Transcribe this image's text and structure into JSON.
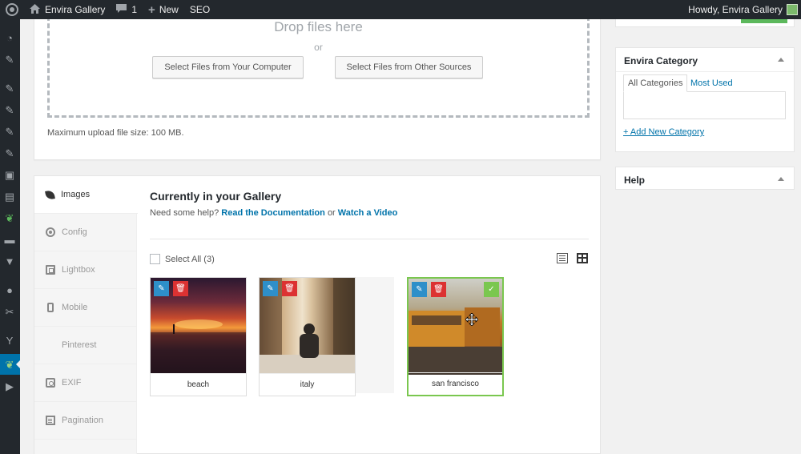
{
  "adminbar": {
    "site_name": "Envira Gallery",
    "comments_count": "1",
    "new_label": "New",
    "seo_label": "SEO",
    "greeting": "Howdy, Envira Gallery"
  },
  "upload": {
    "drop_text": "Drop files here",
    "or_text": "or",
    "btn_computer": "Select Files from Your Computer",
    "btn_other": "Select Files from Other Sources",
    "max_size": "Maximum upload file size: 100 MB."
  },
  "gallery": {
    "tabs": [
      {
        "label": "Images",
        "icon": "leaf-icon"
      },
      {
        "label": "Config",
        "icon": "gear-icon"
      },
      {
        "label": "Lightbox",
        "icon": "lightbox-icon"
      },
      {
        "label": "Mobile",
        "icon": "mobile-icon"
      },
      {
        "label": "Pinterest",
        "icon": "pinterest-icon"
      },
      {
        "label": "EXIF",
        "icon": "camera-icon"
      },
      {
        "label": "Pagination",
        "icon": "pagination-icon"
      }
    ],
    "title": "Currently in your Gallery",
    "help_prefix": "Need some help?",
    "help_doc_link": "Read the Documentation",
    "help_or": "or",
    "help_video_link": "Watch a Video",
    "select_all": "Select All (3)",
    "images": [
      {
        "label": "beach",
        "selected": false
      },
      {
        "label": "italy",
        "selected": false
      },
      {
        "label": "san francisco",
        "selected": true
      }
    ]
  },
  "sidebar": {
    "category_title": "Envira Category",
    "tab_all": "All Categories",
    "tab_used": "Most Used",
    "add_category": "+ Add New Category",
    "help_title": "Help"
  },
  "colors": {
    "accent": "#0073aa",
    "selected_border": "#7ac74f",
    "delete": "#dc3232",
    "edit": "#2e8fc9"
  }
}
